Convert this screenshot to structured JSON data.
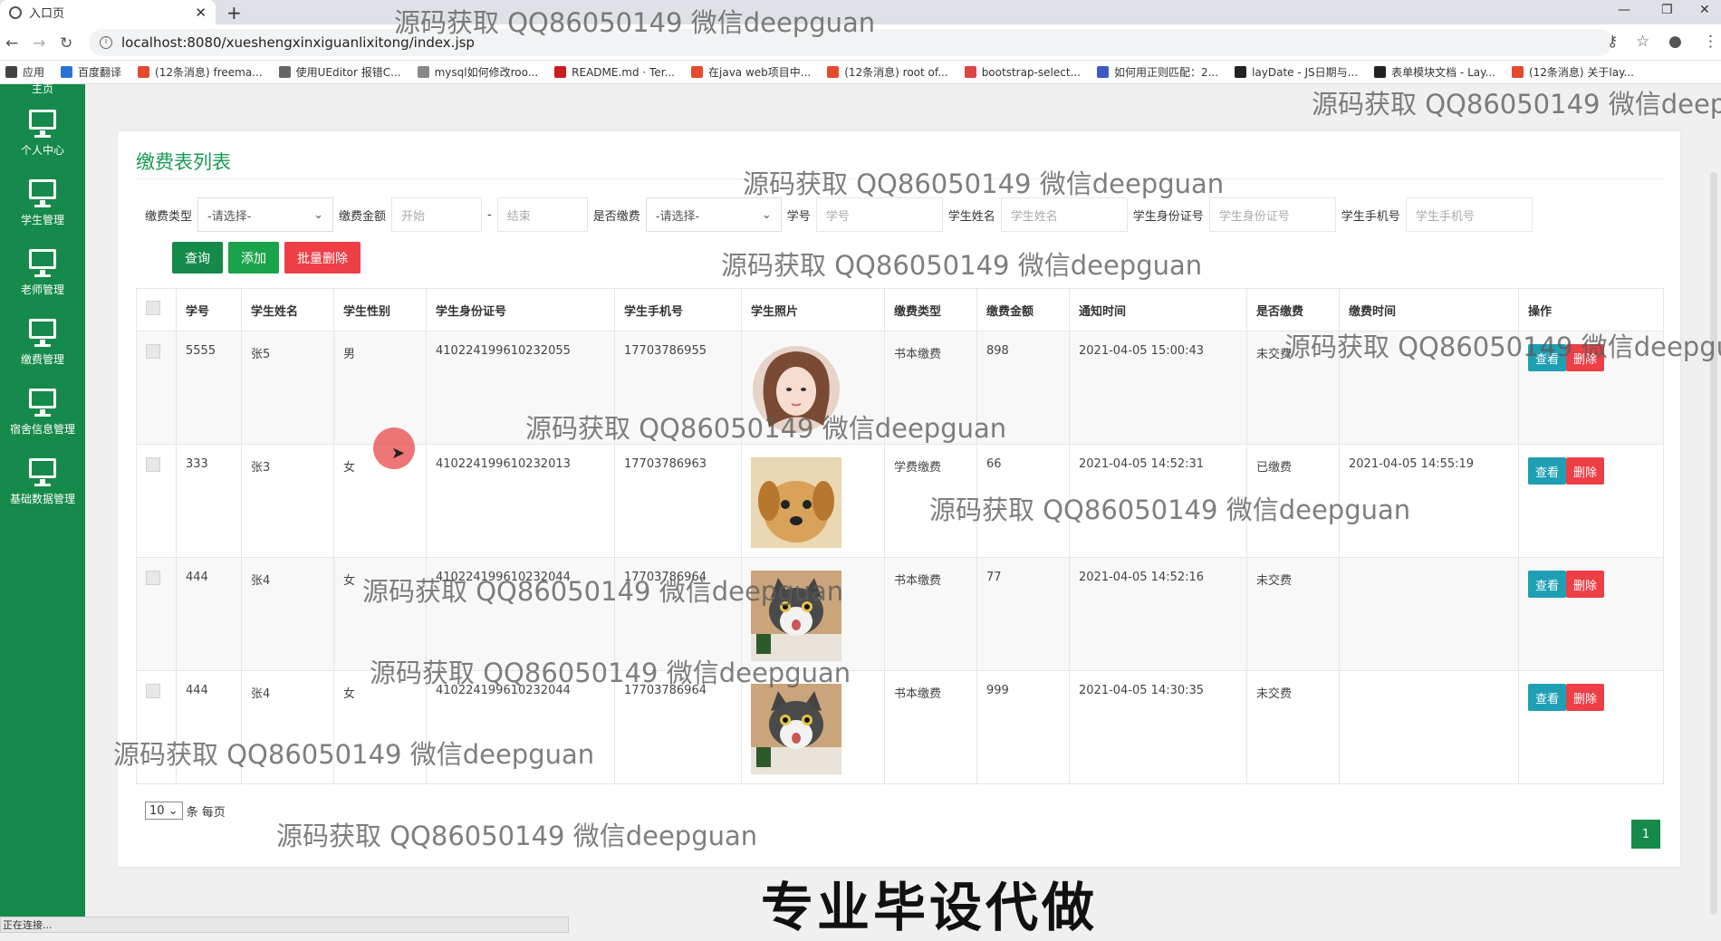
{
  "browser": {
    "tab_title": "入口页",
    "new_tab": "+",
    "url": "localhost:8080/xueshengxinxiguanlixitong/index.jsp",
    "bookmarks": [
      {
        "label": "应用",
        "color": "#444"
      },
      {
        "label": "百度翻译",
        "color": "#2b72d9"
      },
      {
        "label": "(12条消息) freema...",
        "color": "#e34b2c"
      },
      {
        "label": "使用UEditor 报错C...",
        "color": "#666"
      },
      {
        "label": "mysql如何修改roo...",
        "color": "#888"
      },
      {
        "label": "README.md · Ter...",
        "color": "#c71d23"
      },
      {
        "label": "在java web项目中...",
        "color": "#e34b2c"
      },
      {
        "label": "(12条消息) root of...",
        "color": "#e34b2c"
      },
      {
        "label": "bootstrap-select...",
        "color": "#d44"
      },
      {
        "label": "如何用正则匹配：2...",
        "color": "#3a5cc2"
      },
      {
        "label": "layDate - JS日期与...",
        "color": "#222"
      },
      {
        "label": "表单模块文档 - Lay...",
        "color": "#222"
      },
      {
        "label": "(12条消息) 关于lay...",
        "color": "#e34b2c"
      }
    ]
  },
  "sidebar": {
    "top_label": "主页",
    "items": [
      {
        "label": "个人中心"
      },
      {
        "label": "学生管理"
      },
      {
        "label": "老师管理"
      },
      {
        "label": "缴费管理"
      },
      {
        "label": "宿舍信息管理"
      },
      {
        "label": "基础数据管理"
      }
    ]
  },
  "panel": {
    "title": "缴费表列表",
    "filters": {
      "type_label": "缴费类型",
      "type_value": "-请选择-",
      "amount_label": "缴费金额",
      "amount_start": "开始",
      "amount_dash": "-",
      "amount_end": "结束",
      "paid_label": "是否缴费",
      "paid_value": "-请选择-",
      "xuehao_label": "学号",
      "xuehao_ph": "学号",
      "name_label": "学生姓名",
      "name_ph": "学生姓名",
      "idcard_label": "学生身份证号",
      "idcard_ph": "学生身份证号",
      "phone_label": "学生手机号",
      "phone_ph": "学生手机号"
    },
    "buttons": {
      "query": "查询",
      "add": "添加",
      "batch_delete": "批量删除"
    },
    "columns": [
      "学号",
      "学生姓名",
      "学生性别",
      "学生身份证号",
      "学生手机号",
      "学生照片",
      "缴费类型",
      "缴费金额",
      "通知时间",
      "是否缴费",
      "缴费时间",
      "操作"
    ],
    "rows": [
      {
        "xuehao": "5555",
        "name": "张5",
        "sex": "男",
        "idcard": "410224199610232055",
        "phone": "17703786955",
        "photo": "avatar-girl",
        "type": "书本缴费",
        "amount": "898",
        "notice": "2021-04-05 15:00:43",
        "paid": "未交费",
        "paytime": ""
      },
      {
        "xuehao": "333",
        "name": "张3",
        "sex": "女",
        "idcard": "410224199610232013",
        "phone": "17703786963",
        "photo": "puppy",
        "type": "学费缴费",
        "amount": "66",
        "notice": "2021-04-05 14:52:31",
        "paid": "已缴费",
        "paytime": "2021-04-05 14:55:19"
      },
      {
        "xuehao": "444",
        "name": "张4",
        "sex": "女",
        "idcard": "410224199610232044",
        "phone": "17703786964",
        "photo": "cat",
        "type": "书本缴费",
        "amount": "77",
        "notice": "2021-04-05 14:52:16",
        "paid": "未交费",
        "paytime": ""
      },
      {
        "xuehao": "444",
        "name": "张4",
        "sex": "女",
        "idcard": "410224199610232044",
        "phone": "17703786964",
        "photo": "cat",
        "type": "书本缴费",
        "amount": "999",
        "notice": "2021-04-05 14:30:35",
        "paid": "未交费",
        "paytime": ""
      }
    ],
    "row_actions": {
      "view": "查看",
      "delete": "删除"
    },
    "pagination": {
      "page_size": "10",
      "per_page_label": "条 每页",
      "current_page": "1"
    }
  },
  "status_bar": "正在连接...",
  "overlay_text": "专业毕设代做",
  "watermark": "源码获取 QQ86050149 微信deepguan",
  "colors": {
    "primary": "#168a4a",
    "view": "#1e9fb4",
    "danger": "#ee3e46",
    "add": "#1aa34a"
  }
}
